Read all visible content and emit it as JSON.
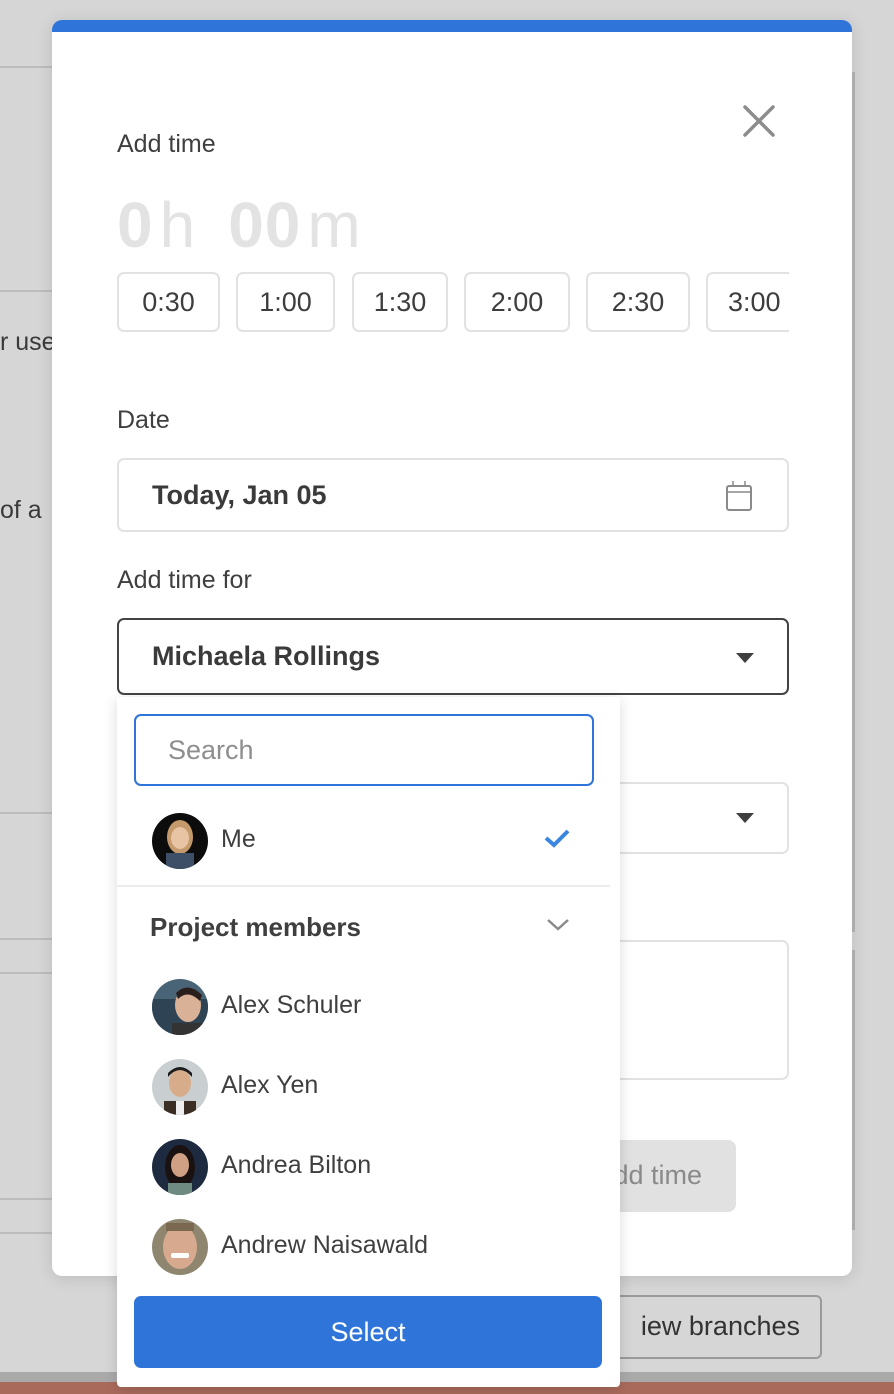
{
  "background": {
    "partial_text_1": "r use",
    "partial_text_2": "of a",
    "branches_button": "iew branches"
  },
  "modal": {
    "accent_color": "#2e74d9",
    "title": "Add time",
    "duration": {
      "hours": "0",
      "hours_unit": "h",
      "minutes": "00",
      "minutes_unit": "m"
    },
    "presets": [
      "0:30",
      "1:00",
      "1:30",
      "2:00",
      "2:30",
      "3:00"
    ],
    "date_label": "Date",
    "date_value": "Today, Jan 05",
    "add_time_for_label": "Add time for",
    "add_time_for_value": "Michaela Rollings",
    "add_time_button": "Add time"
  },
  "dropdown": {
    "search_placeholder": "Search",
    "me": {
      "name": "Me",
      "selected": true
    },
    "section_header": "Project members",
    "members": [
      {
        "name": "Alex Schuler"
      },
      {
        "name": "Alex Yen"
      },
      {
        "name": "Andrea Bilton"
      },
      {
        "name": "Andrew Naisawald"
      }
    ],
    "select_button": "Select"
  }
}
